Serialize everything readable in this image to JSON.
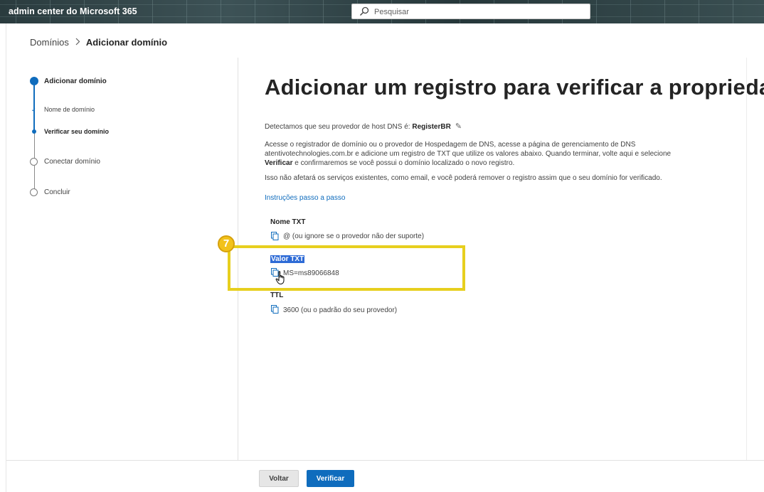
{
  "app": {
    "title": "admin center do Microsoft 365",
    "search_placeholder": "Pesquisar"
  },
  "breadcrumb": {
    "parent": "Domínios",
    "separator": ">",
    "current": "Adicionar domínio"
  },
  "steps": [
    {
      "label": "Adicionar domínio",
      "state": "current"
    },
    {
      "label": "Nome de domínio",
      "state": "completed"
    },
    {
      "label": "Verificar seu domínio",
      "state": "current"
    },
    {
      "label": "Conectar domínio",
      "state": "pending"
    },
    {
      "label": "Concluir",
      "state": "pending"
    }
  ],
  "main": {
    "title": "Adicionar um registro para verificar a propriedade",
    "detect_prefix": "Detectamos que seu provedor de host DNS é: ",
    "detect_provider": "RegisterBR",
    "instructions_line1": "Acesse o registrador de domínio ou o provedor de Hospedagem de DNS, acesse a página de gerenciamento de DNS",
    "instructions_line2": "atentivotechnologies.com.br e adicione um registro de TXT que utilize os valores abaixo. Quando terminar, volte aqui e selecione",
    "instructions_verify_word": "Verificar",
    "instructions_line3_rest": " e confirmaremos se você possui o domínio localizado o novo registro.",
    "note": "Isso não afetará os serviços existentes, como email, e você poderá remover o registro assim que o seu domínio for verificado.",
    "step_by_step_link": "Instruções passo a passo"
  },
  "records": {
    "txt_name_label": "Nome TXT",
    "txt_name_value": "@ (ou ignore se o provedor não der suporte)",
    "txt_value_label": "Valor TXT",
    "txt_value_value": "MS=ms89066848",
    "ttl_label": "TTL",
    "ttl_value": "3600 (ou o padrão do seu provedor)"
  },
  "annotation": {
    "step_number": "7",
    "highlight_color": "#e7cf1e"
  },
  "footer": {
    "back_label": "Voltar",
    "verify_label": "Verificar"
  },
  "colors": {
    "accent": "#0f6cbd",
    "selection": "#2e6bd6"
  },
  "icons": {
    "search": "search-icon",
    "edit": "pencil-icon",
    "copy": "copy-icon",
    "cursor": "hand-pointer-icon"
  }
}
